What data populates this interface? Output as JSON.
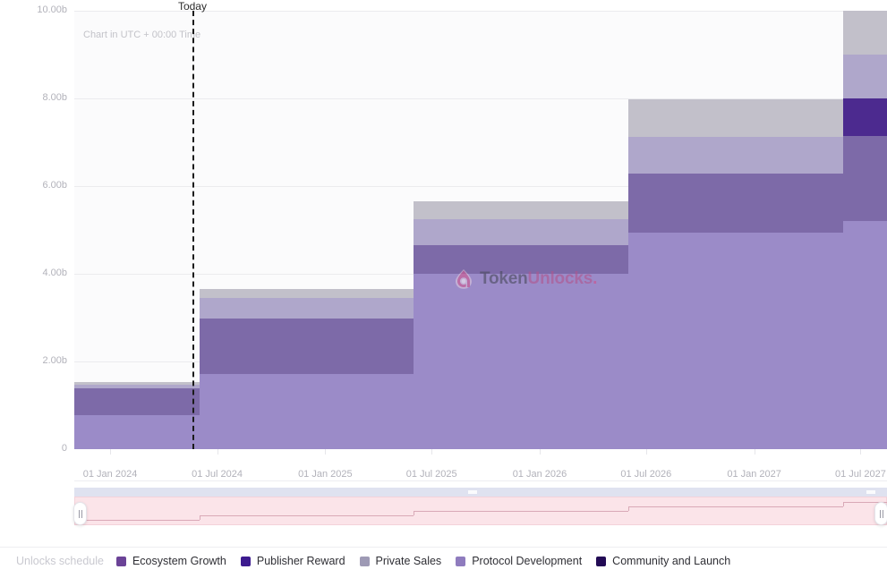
{
  "chart_data": {
    "type": "area",
    "title": "",
    "subtitle": "Chart in UTC + 00:00 Time",
    "xlabel": "",
    "ylabel": "",
    "ylim": [
      0,
      10000000000
    ],
    "grid": true,
    "legend_position": "bottom",
    "stacked": true,
    "step": true,
    "y_ticks": [
      {
        "label": "0",
        "value": 0
      },
      {
        "label": "2.00b",
        "value": 2000000000
      },
      {
        "label": "4.00b",
        "value": 4000000000
      },
      {
        "label": "6.00b",
        "value": 6000000000
      },
      {
        "label": "8.00b",
        "value": 8000000000
      },
      {
        "label": "10.00b",
        "value": 10000000000
      }
    ],
    "x_ticks": [
      {
        "label": "01 Jan 2024",
        "value": "2024-01-01"
      },
      {
        "label": "01 Jul 2024",
        "value": "2024-07-01"
      },
      {
        "label": "01 Jan 2025",
        "value": "2025-01-01"
      },
      {
        "label": "01 Jul 2025",
        "value": "2025-07-01"
      },
      {
        "label": "01 Jan 2026",
        "value": "2026-01-01"
      },
      {
        "label": "01 Jul 2026",
        "value": "2026-07-01"
      },
      {
        "label": "01 Jan 2027",
        "value": "2027-01-01"
      },
      {
        "label": "01 Jul 2027",
        "value": "2027-07-01"
      }
    ],
    "x_range": [
      "2023-11-01",
      "2027-08-15"
    ],
    "categories": [
      "2023-11-01",
      "2024-06-01",
      "2025-06-01",
      "2026-06-01",
      "2027-06-01"
    ],
    "series": [
      {
        "name": "Protocol Development",
        "color": "#9b8bc8",
        "values": [
          0.78,
          1.72,
          4.0,
          4.93,
          5.2
        ]
      },
      {
        "name": "Ecosystem Growth",
        "color": "#7d6aa8",
        "values": [
          0.6,
          1.25,
          0.66,
          1.36,
          1.95
        ]
      },
      {
        "name": "Publisher Reward",
        "color": "#4c2a8f",
        "values": [
          0.0,
          0.0,
          0.0,
          0.0,
          0.86
        ]
      },
      {
        "name": "Private Sales",
        "color": "#afa7cb",
        "values": [
          0.08,
          0.48,
          0.58,
          0.83,
          0.98
        ]
      },
      {
        "name": "Community and Launch",
        "color": "#240e53",
        "values": [
          0.0,
          0.2,
          0.46,
          0.81,
          1.01
        ]
      }
    ],
    "series_top_cap": {
      "name": "Private Sales grey cap",
      "color": "#c2c0ca",
      "values": [
        0.08,
        0.21,
        0.41,
        0.86,
        1.01
      ]
    },
    "totals": [
      1.46,
      3.65,
      5.7,
      7.92,
      10.0
    ],
    "totals_unit": "b",
    "today_marker": {
      "label": "Today",
      "value": "2024-05-20"
    },
    "watermark": {
      "text_primary": "Token",
      "text_secondary": "Unlocks",
      "text_dot": ".",
      "icon": "lock-droplet-icon",
      "color_primary": "#4b4b5e",
      "color_secondary": "#b0568f"
    }
  },
  "legend": {
    "title": "Unlocks schedule",
    "items": [
      {
        "label": "Ecosystem Growth",
        "color": "#6b4397"
      },
      {
        "label": "Publisher Reward",
        "color": "#3d1b8f"
      },
      {
        "label": "Private Sales",
        "color": "#9e9ab5"
      },
      {
        "label": "Protocol Development",
        "color": "#8f7cbe"
      },
      {
        "label": "Community and Launch",
        "color": "#230b55"
      }
    ]
  },
  "range_slider": {
    "left_handle_label": "drag-left",
    "right_handle_label": "drag-right",
    "track_color": "#fbe4e9",
    "topbar_color": "#dfe2f0"
  },
  "colors": {
    "today_line": "#1b1b1b",
    "axis_text": "#b2b2ba",
    "grid": "#ebebee",
    "plot_bg": "#fbfbfc"
  }
}
